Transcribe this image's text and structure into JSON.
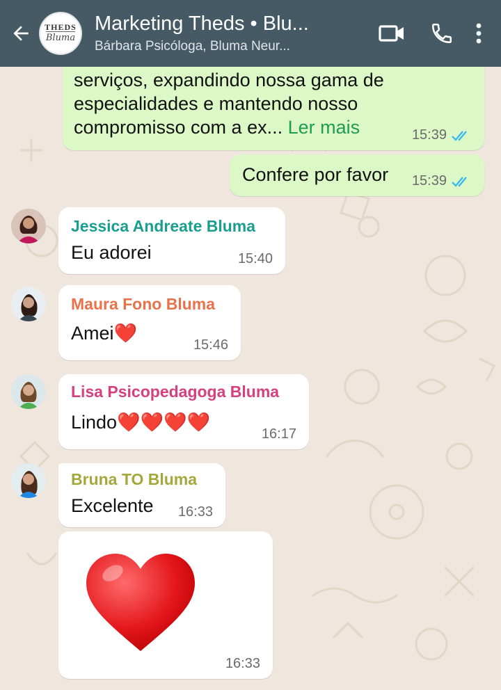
{
  "header": {
    "title": "Marketing Theds • Blu...",
    "subtitle": "Bárbara Psicóloga, Bluma Neur...",
    "avatar_line1": "THEDS",
    "avatar_line2": "Bluma",
    "icons": [
      "back-arrow-icon",
      "video-call-icon",
      "phone-icon",
      "more-vert-icon"
    ]
  },
  "messages": {
    "m1": {
      "text_prefix": "serviços, expandindo nossa gama de especialidades e mantendo nosso compromisso com a ex...",
      "read_more": "Ler mais",
      "time": "15:39"
    },
    "m2": {
      "text": "Confere por favor",
      "time": "15:39"
    },
    "m3": {
      "sender": "Jessica Andreate Bluma",
      "text": "Eu adorei",
      "time": "15:40"
    },
    "m4": {
      "sender": "Maura Fono Bluma",
      "text": "Amei",
      "emoji": "❤️",
      "time": "15:46"
    },
    "m5": {
      "sender": "Lisa Psicopedagoga Bluma",
      "text": "Lindo",
      "emoji": "❤️❤️❤️❤️",
      "time": "16:17"
    },
    "m6": {
      "sender": "Bruna TO Bluma",
      "text": "Excelente",
      "time": "16:33"
    },
    "m7": {
      "emoji_icon": "big-heart-emoji",
      "time": "16:33"
    }
  },
  "colors": {
    "header_bg": "#455a64",
    "chat_bg": "#efe7dd",
    "outgoing_bubble": "#dcf8c6",
    "read_ticks": "#34b7f1",
    "sender_jessica": "#1a9e8f",
    "sender_maura": "#e8724a",
    "sender_lisa": "#d6407e",
    "sender_bruna": "#a4a83a"
  }
}
